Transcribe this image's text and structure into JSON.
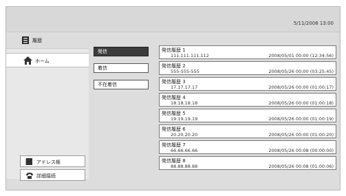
{
  "status": {
    "datetime": "5/11/2008 13:00"
  },
  "header": {
    "title": "履歴",
    "icon": "history-book-icon"
  },
  "sidebar": {
    "home_label": "ホーム",
    "address_book_label": "アドレス帳",
    "advanced_label": "詳細接続"
  },
  "tabs": [
    {
      "label": "発信",
      "active": true
    },
    {
      "label": "着信",
      "active": false
    },
    {
      "label": "不在着信",
      "active": false
    }
  ],
  "history": [
    {
      "title": "発信履歴 1",
      "number": "111.111.111.112",
      "datetime": "2008/05/01 00:00 (12:34:56)"
    },
    {
      "title": "発信履歴 2",
      "number": "555-555-555",
      "datetime": "2008/05/26 00:00 (03:25:45)"
    },
    {
      "title": "発信履歴 3",
      "number": "17.17.17.17",
      "datetime": "2008/05/26 00:00 (01:00:17)"
    },
    {
      "title": "発信履歴 4",
      "number": "18.18.18.18",
      "datetime": "2008/05/26 00:00 (01:00:18)"
    },
    {
      "title": "発信履歴 5",
      "number": "19.19.19.19",
      "datetime": "2008/05/26 00:00 (01:00:19)"
    },
    {
      "title": "発信履歴 6",
      "number": "20.20.20.20",
      "datetime": "2008/05/26 00:00 (01:00:20)"
    },
    {
      "title": "発信履歴 7",
      "number": "66.66.66.66",
      "datetime": "2008/05/26 00:08 (00:00:00)"
    },
    {
      "title": "発信履歴 8",
      "number": "88.88.88.88",
      "datetime": "2008/05/26 00:08 (01:00:06)"
    }
  ],
  "colors": {
    "active_tab": "#3c3c3c",
    "background": "#dddddd"
  }
}
